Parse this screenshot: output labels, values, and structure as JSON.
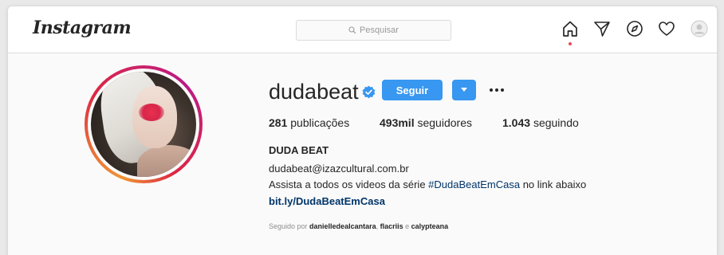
{
  "nav": {
    "logo": "Instagram",
    "search_placeholder": "Pesquisar",
    "icons": [
      "home-icon",
      "direct-icon",
      "explore-icon",
      "activity-heart-icon",
      "profile-avatar-icon"
    ]
  },
  "profile": {
    "username": "dudabeat",
    "verified": true,
    "follow_label": "Seguir",
    "stats": {
      "posts_count": "281",
      "posts_label": "publicações",
      "followers_count": "493mil",
      "followers_label": "seguidores",
      "following_count": "1.043",
      "following_label": "seguindo"
    },
    "full_name": "DUDA BEAT",
    "bio": {
      "email": "dudabeat@izazcultural.com.br",
      "text_before": "Assista a todos os videos da série ",
      "hashtag": "#DudaBeatEmCasa",
      "text_after": " no link abaixo",
      "link": "bit.ly/DudaBeatEmCasa"
    },
    "followed_by": {
      "prefix": "Seguido por ",
      "user1": "danielledealcantara",
      "separator": ", ",
      "user2": "flacriis",
      "conjunction": " e ",
      "user3": "calypteana"
    }
  },
  "colors": {
    "accent": "#3897f0",
    "link": "#003569",
    "notification": "#ed4956"
  }
}
